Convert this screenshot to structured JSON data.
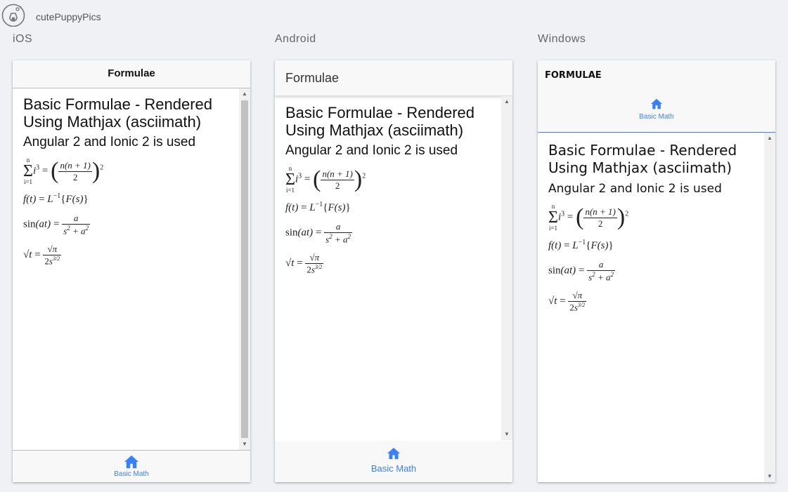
{
  "app": {
    "name": "cutePuppyPics"
  },
  "colors": {
    "accent": "#3880ff",
    "background": "#eff1f4",
    "header_gray": "#f8f8f8"
  },
  "platforms": {
    "ios": "iOS",
    "android": "Android",
    "windows": "Windows"
  },
  "page": {
    "header_title": "Formulae",
    "header_title_windows": "FORMULAE",
    "heading": "Basic Formulae - Rendered Using Mathjax (asciimath)",
    "subheading": "Angular 2 and Ionic 2 is used",
    "formulas": [
      "sum_(i=1)^n i^3 = ((n(n+1))/2)^2",
      "f(t) = L^-1{F(s)}",
      "sin(at) = a/(s^2+a^2)",
      "sqrt(t) = sqrt(pi)/(2s^(3/2))"
    ]
  },
  "tab": {
    "label": "Basic Math",
    "icon": "home-icon"
  }
}
